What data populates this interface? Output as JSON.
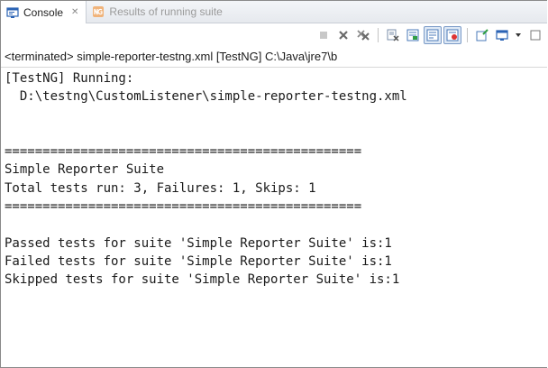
{
  "tabs": [
    {
      "label": "Console",
      "close": "✕",
      "active": true
    },
    {
      "label": "Results of running suite",
      "active": false
    }
  ],
  "toolbar": {
    "icons": [
      "stop-icon",
      "remove-launch-icon",
      "remove-all-icon",
      "clear-console-icon",
      "scroll-lock-icon",
      "word-wrap-icon",
      "show-on-output-icon",
      "pin-console-icon",
      "display-selected-console-icon",
      "dropdown-arrow-icon",
      "open-console-icon"
    ]
  },
  "status": "<terminated> simple-reporter-testng.xml [TestNG] C:\\Java\\jre7\\b",
  "console_lines": [
    "[TestNG] Running:",
    "  D:\\testng\\CustomListener\\simple-reporter-testng.xml",
    "",
    "",
    "===============================================",
    "Simple Reporter Suite",
    "Total tests run: 3, Failures: 1, Skips: 1",
    "===============================================",
    "",
    "Passed tests for suite 'Simple Reporter Suite' is:1",
    "Failed tests for suite 'Simple Reporter Suite' is:1",
    "Skipped tests for suite 'Simple Reporter Suite' is:1"
  ],
  "colors": {
    "accent": "#2b63b5",
    "testng": "#e07a1f"
  }
}
